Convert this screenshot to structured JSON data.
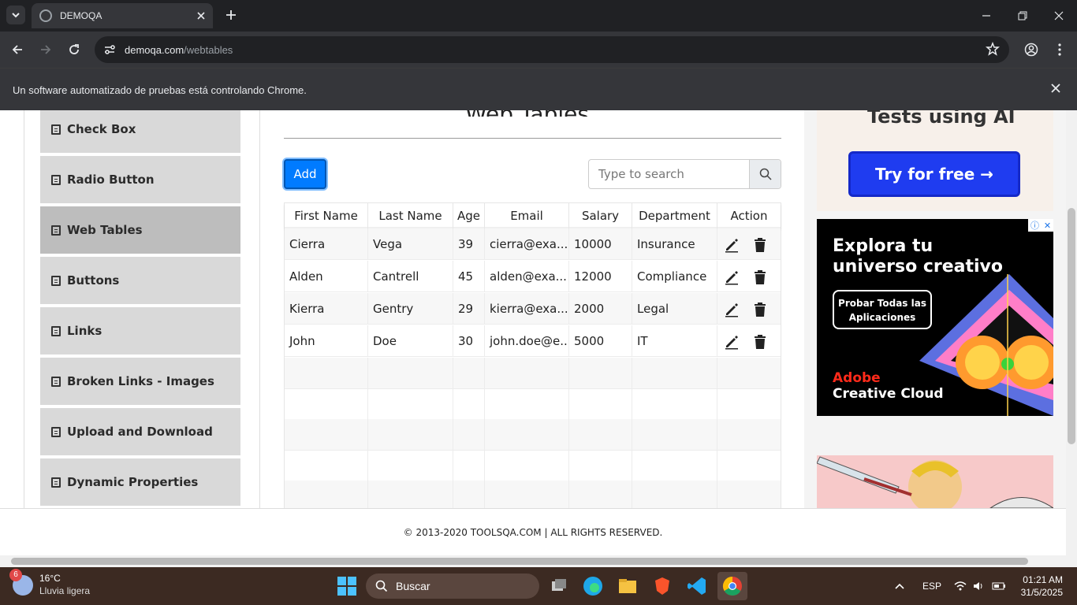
{
  "browser": {
    "tab_title": "DEMOQA",
    "url_host": "demoqa.com",
    "url_path": "/webtables",
    "infobar_message": "Un software automatizado de pruebas está controlando Chrome."
  },
  "sidebar": {
    "items": [
      {
        "label": "Check Box"
      },
      {
        "label": "Radio Button"
      },
      {
        "label": "Web Tables"
      },
      {
        "label": "Buttons"
      },
      {
        "label": "Links"
      },
      {
        "label": "Broken Links - Images"
      },
      {
        "label": "Upload and Download"
      },
      {
        "label": "Dynamic Properties"
      }
    ],
    "active_item": "Web Tables"
  },
  "main": {
    "title": "Web Tables",
    "add_label": "Add",
    "search_placeholder": "Type to search",
    "columns": [
      "First Name",
      "Last Name",
      "Age",
      "Email",
      "Salary",
      "Department",
      "Action"
    ],
    "rows": [
      [
        "Cierra",
        "Vega",
        "39",
        "cierra@exa...",
        "10000",
        "Insurance"
      ],
      [
        "Alden",
        "Cantrell",
        "45",
        "alden@exa...",
        "12000",
        "Compliance"
      ],
      [
        "Kierra",
        "Gentry",
        "29",
        "kierra@exa...",
        "2000",
        "Legal"
      ],
      [
        "John",
        "Doe",
        "30",
        "john.doe@e...",
        "5000",
        "IT"
      ]
    ]
  },
  "ads": {
    "ad1_title": "Tests using AI",
    "ad1_cta": "Try for free →",
    "ad2_headline": "Explora tu universo creativo",
    "ad2_button": "Probar Todas las Aplicaciones",
    "ad2_brand_line1": "Adobe",
    "ad2_brand_line2": "Creative Cloud"
  },
  "footer": {
    "text": "© 2013-2020 TOOLSQA.COM | ALL RIGHTS RESERVED."
  },
  "taskbar": {
    "weather_temp": "16°C",
    "weather_desc": "Lluvia ligera",
    "weather_badge": "6",
    "search_label": "Buscar",
    "language": "ESP",
    "time": "01:21 AM",
    "date": "31/5/2025"
  },
  "colors": {
    "primary": "#007bff",
    "active_menu": "#bdbdbd",
    "menu": "#d9d9d9"
  }
}
